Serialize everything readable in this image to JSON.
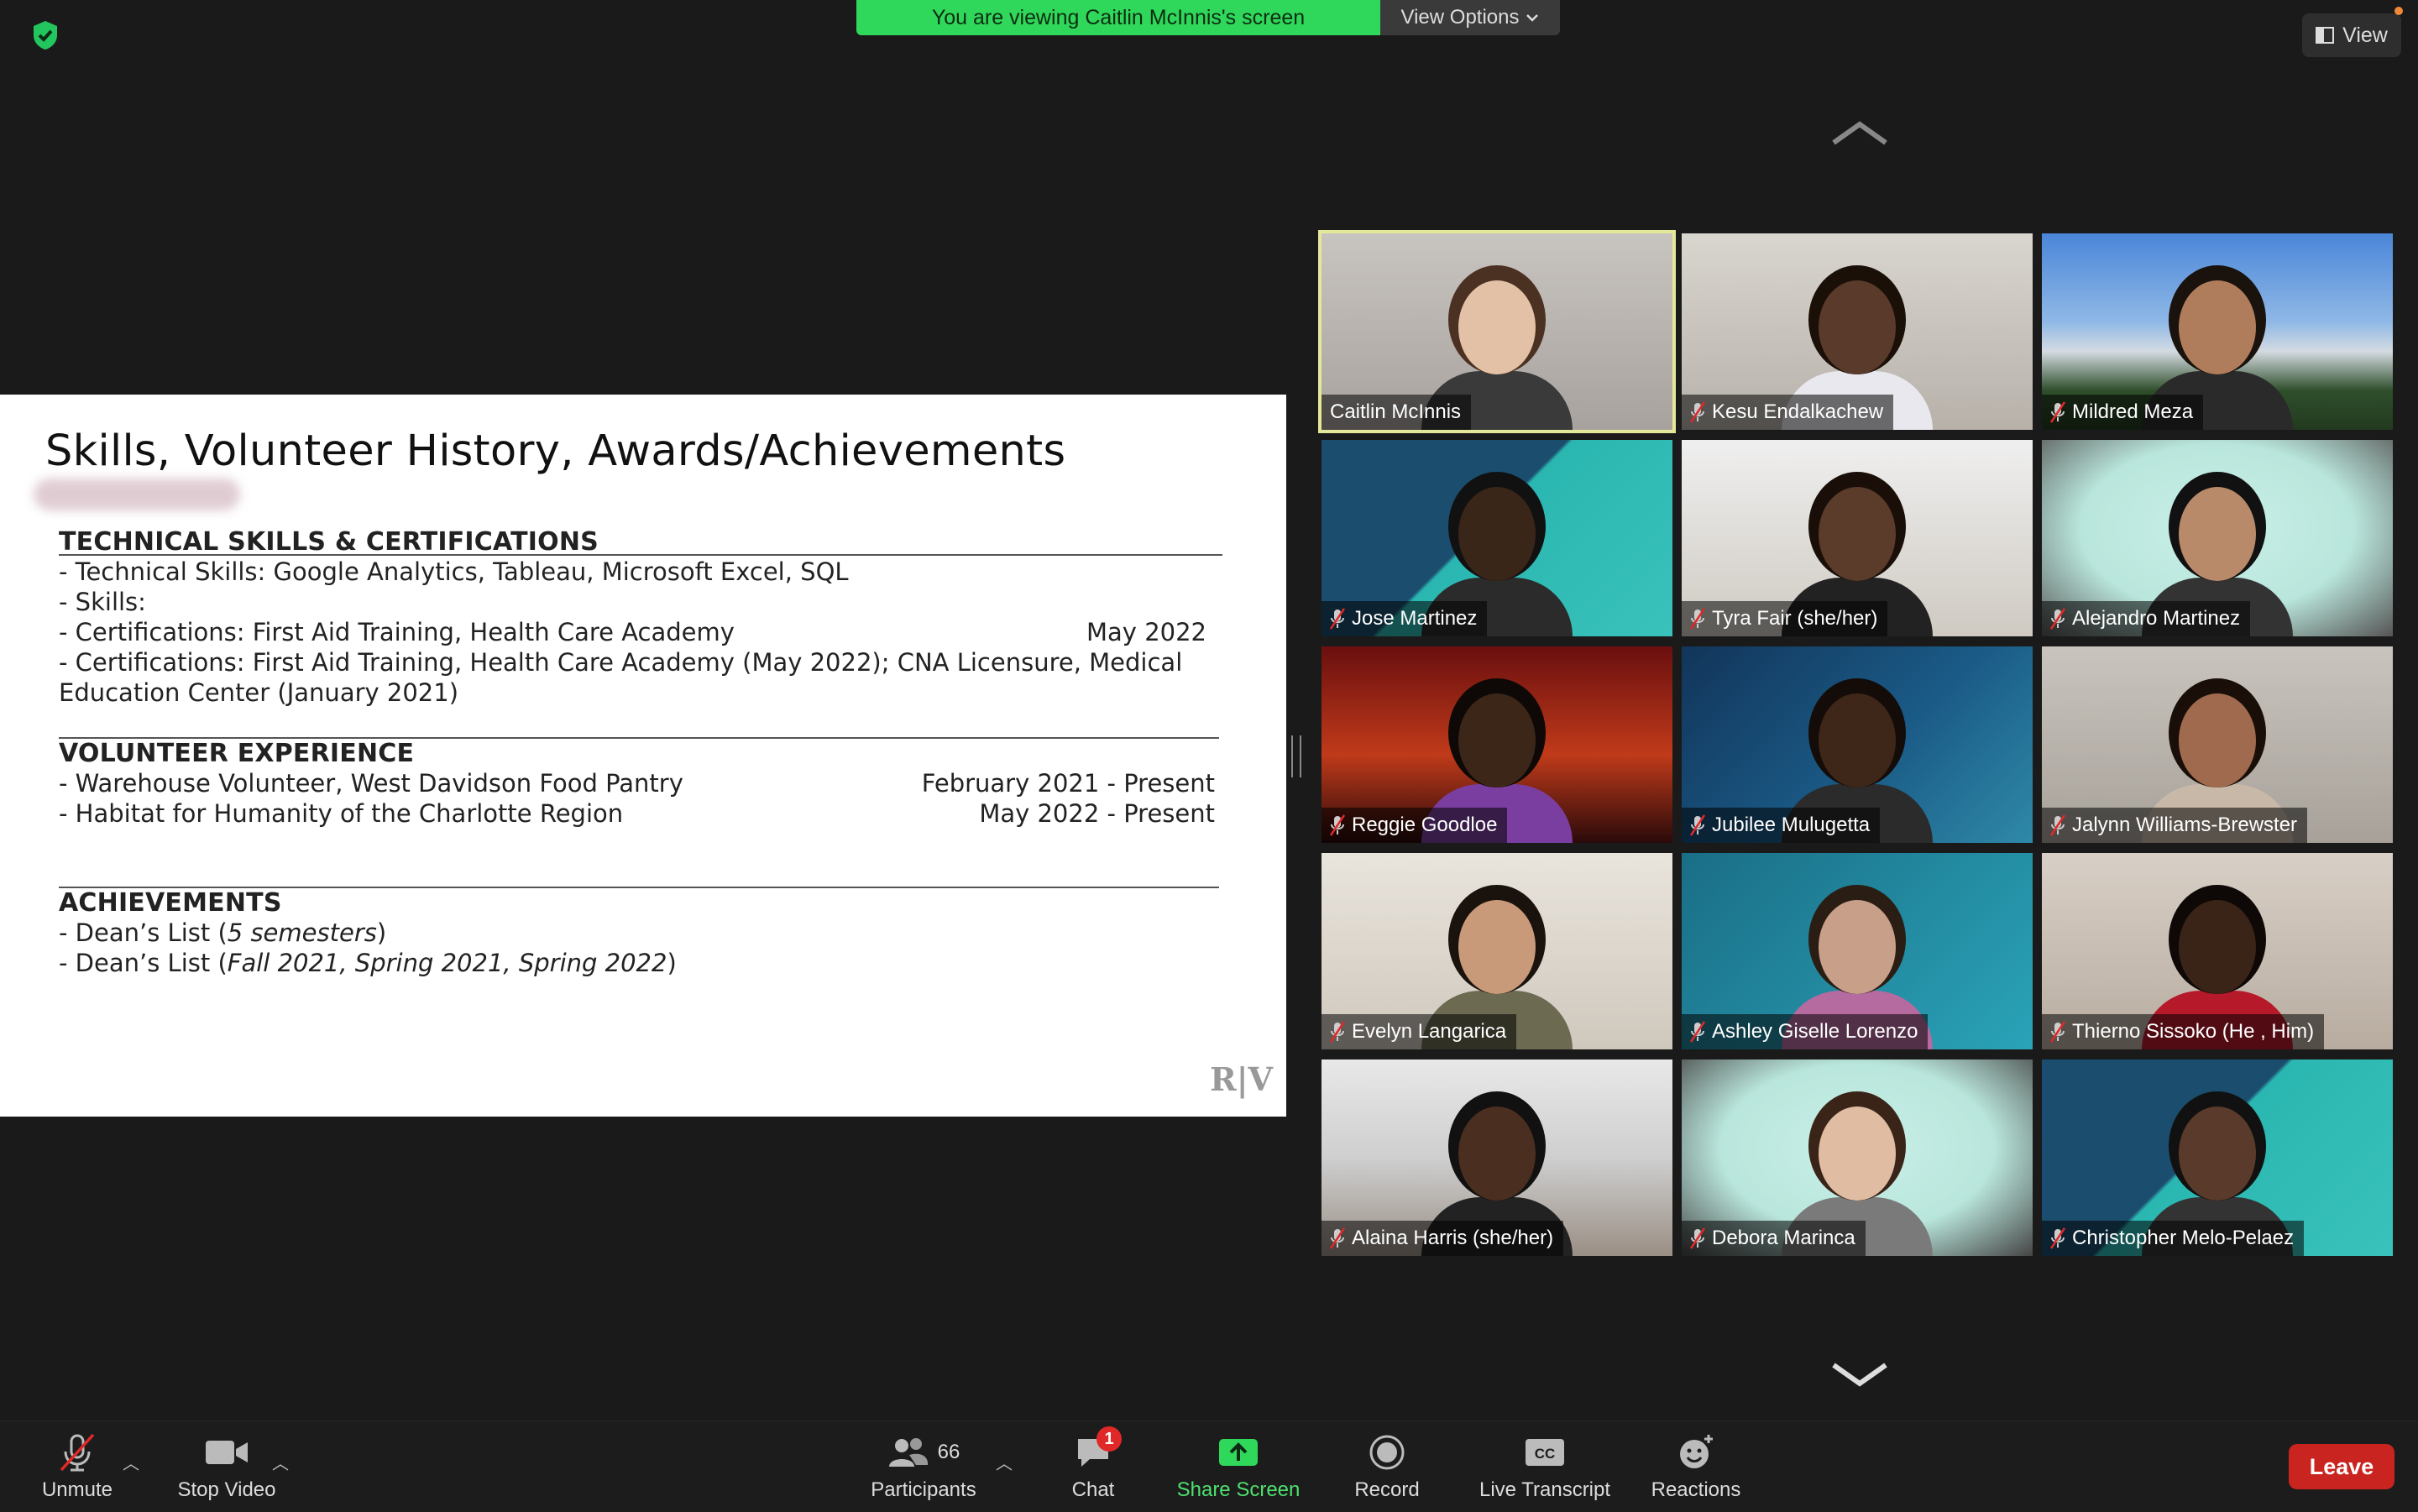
{
  "banner": {
    "text": "You are viewing Caitlin McInnis's screen",
    "options_label": "View Options"
  },
  "view_button": {
    "label": "View"
  },
  "slide": {
    "title": "Skills, Volunteer History, Awards/Achievements",
    "sections": {
      "technical": {
        "heading": "TECHNICAL SKILLS & CERTIFICATIONS",
        "lines": [
          "- Technical Skills: Google Analytics, Tableau, Microsoft Excel, SQL",
          "- Skills:",
          "- Certifications: First Aid Training, Health Care Academy",
          "- Certifications: First Aid Training, Health Care Academy (May 2022); CNA Licensure, Medical",
          "Education Center (January 2021)"
        ],
        "date": "May 2022"
      },
      "volunteer": {
        "heading": "VOLUNTEER EXPERIENCE",
        "lines": [
          "- Warehouse Volunteer, West Davidson Food Pantry",
          "- Habitat for Humanity of the Charlotte Region"
        ],
        "dates": [
          "February 2021 - Present",
          "May 2022 - Present"
        ]
      },
      "achievements": {
        "heading": "ACHIEVEMENTS",
        "line1_prefix": "- Dean’s List (",
        "line1_italic": "5 semesters",
        "line1_suffix": ")",
        "line2_prefix": "- Dean’s List (",
        "line2_italic": "Fall 2021, Spring 2021, Spring 2022",
        "line2_suffix": ")"
      }
    },
    "logo_text": "R|V"
  },
  "participants": [
    {
      "name": "Caitlin McInnis",
      "muted": false
    },
    {
      "name": "Kesu Endalkachew",
      "muted": true
    },
    {
      "name": "Mildred Meza",
      "muted": true
    },
    {
      "name": "Jose Martinez",
      "muted": true
    },
    {
      "name": "Tyra Fair (she/her)",
      "muted": true
    },
    {
      "name": "Alejandro Martinez",
      "muted": true
    },
    {
      "name": "Reggie Goodloe",
      "muted": true
    },
    {
      "name": "Jubilee Mulugetta",
      "muted": true
    },
    {
      "name": "Jalynn Williams-Brewster",
      "muted": true
    },
    {
      "name": "Evelyn Langarica",
      "muted": true
    },
    {
      "name": "Ashley Giselle Lorenzo",
      "muted": true
    },
    {
      "name": "Thierno Sissoko  (He , Him)",
      "muted": true
    },
    {
      "name": "Alaina Harris  (she/her)",
      "muted": true
    },
    {
      "name": "Debora Marinca",
      "muted": true
    },
    {
      "name": "Christopher Melo-Pelaez",
      "muted": true
    }
  ],
  "toolbar": {
    "unmute": "Unmute",
    "stop_video": "Stop Video",
    "participants": "Participants",
    "participants_count": "66",
    "chat": "Chat",
    "chat_badge": "1",
    "share_screen": "Share Screen",
    "record": "Record",
    "live_transcript": "Live Transcript",
    "reactions": "Reactions",
    "leave": "Leave"
  },
  "colors": {
    "banner_green": "#2fd85a",
    "active_speaker": "#e3e89a",
    "share_green": "#2fd85a",
    "leave_red": "#c9241f"
  }
}
